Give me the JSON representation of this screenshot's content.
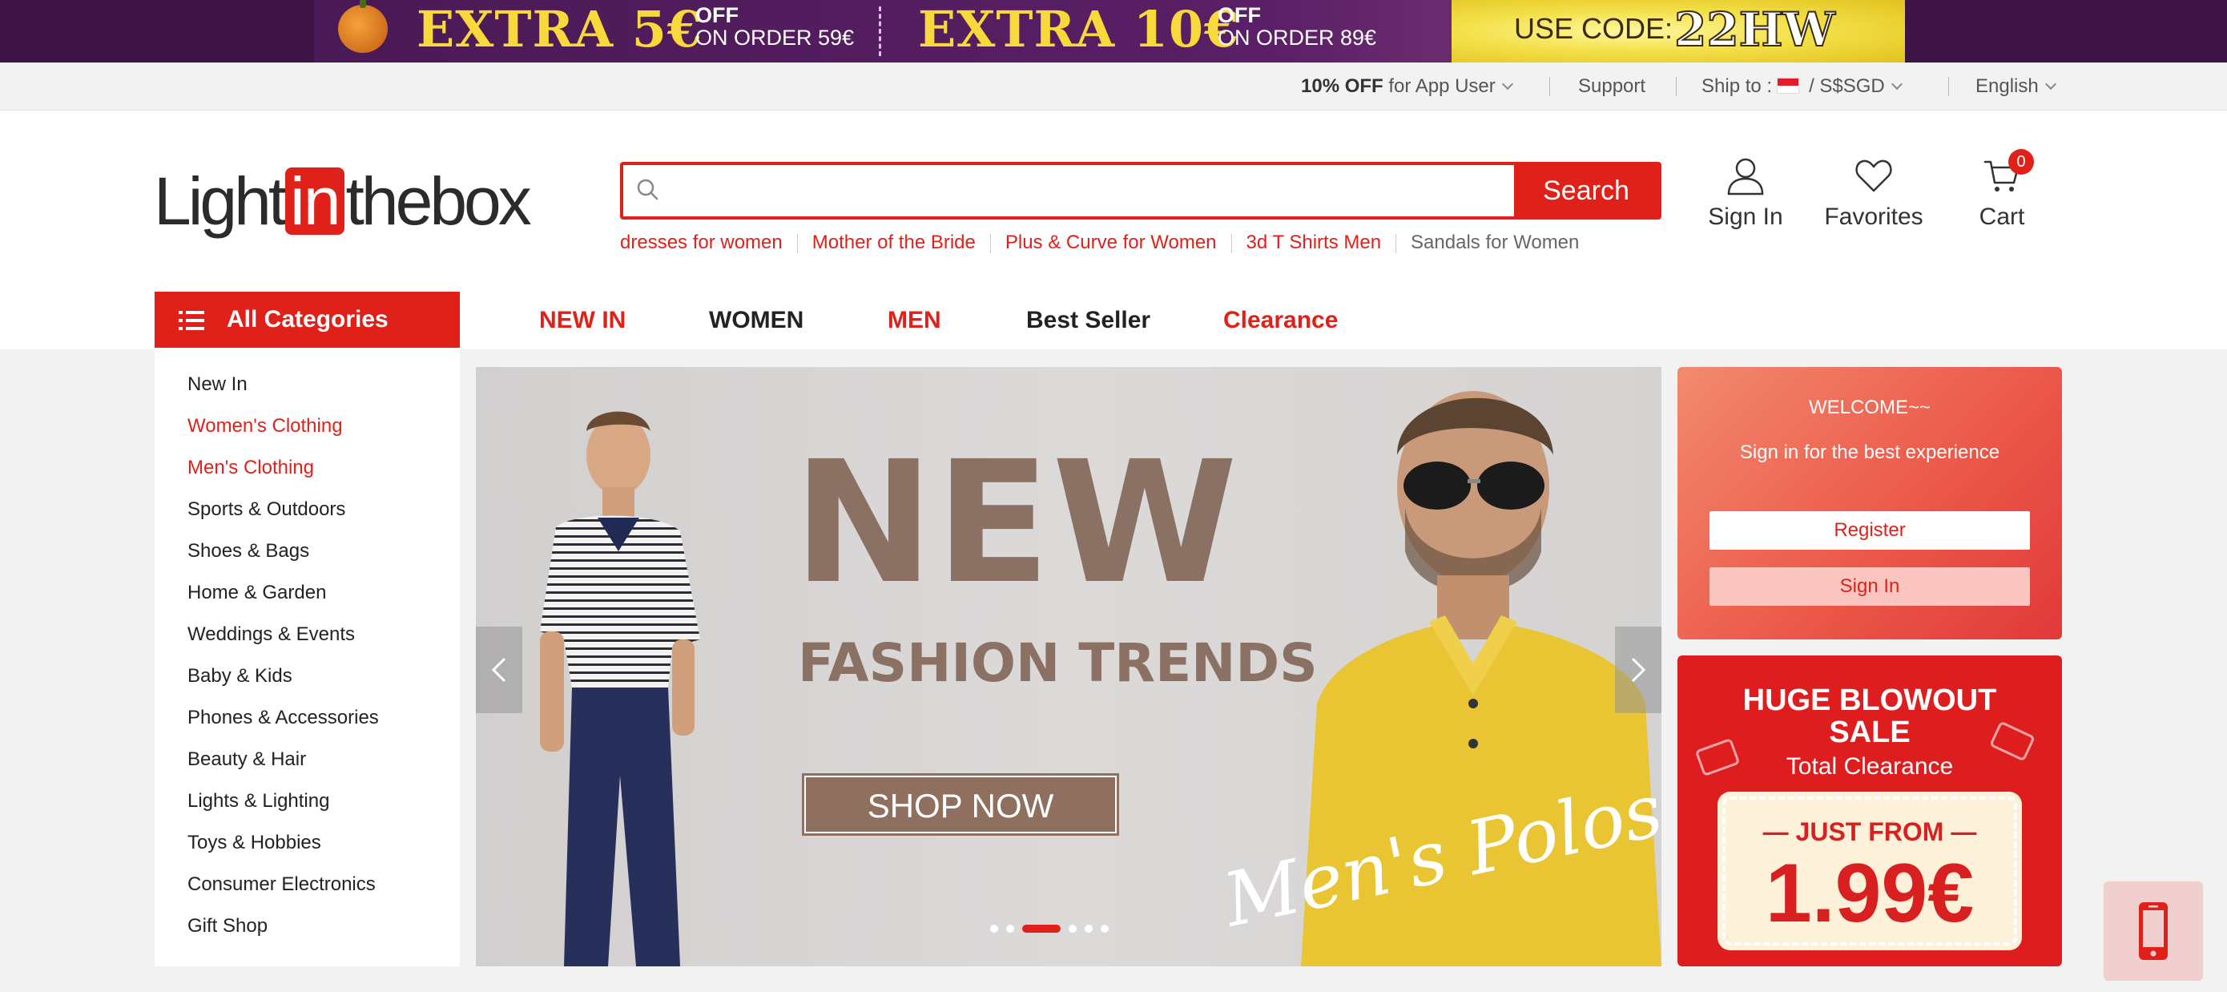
{
  "promo": {
    "offer1_big": "EXTRA 5€",
    "offer1_off": "OFF",
    "offer1_order": "ON ORDER 59€",
    "offer2_big": "EXTRA 10€",
    "offer2_off": "OFF",
    "offer2_order": "ON ORDER 89€",
    "code_label": "USE CODE:",
    "code": "22HW"
  },
  "utility": {
    "app_offer_bold": "10% OFF",
    "app_offer_rest": "for App User",
    "support": "Support",
    "ship_label": "Ship to :",
    "currency": "/ S$SGD",
    "language": "English"
  },
  "header": {
    "logo_left": "Light",
    "logo_in": "in",
    "logo_right": "thebox",
    "search_placeholder": "",
    "search_button": "Search",
    "hot_searches": [
      "dresses for women",
      "Mother of the Bride",
      "Plus & Curve for Women",
      "3d T Shirts Men",
      "Sandals for Women"
    ],
    "sign_in": "Sign In",
    "favorites": "Favorites",
    "cart": "Cart",
    "cart_count": "0"
  },
  "nav": {
    "all_categories": "All Categories",
    "items": [
      "NEW IN",
      "WOMEN",
      "MEN",
      "Best Seller",
      "Clearance"
    ]
  },
  "sidebar": {
    "items": [
      "New In",
      "Women's Clothing",
      "Men's Clothing",
      "Sports & Outdoors",
      "Shoes & Bags",
      "Home & Garden",
      "Weddings & Events",
      "Baby & Kids",
      "Phones & Accessories",
      "Beauty & Hair",
      "Lights & Lighting",
      "Toys & Hobbies",
      "Consumer Electronics",
      "Gift Shop"
    ]
  },
  "hero": {
    "headline": "NEW",
    "subhead": "FASHION TRENDS",
    "cta": "SHOP NOW",
    "script": "Men's Polos",
    "slide_count": 6,
    "active_slide": 3
  },
  "welcome": {
    "title": "WELCOME~~",
    "subtitle": "Sign in for the best experience",
    "register": "Register",
    "sign_in": "Sign In"
  },
  "blowout": {
    "title": "HUGE BLOWOUT SALE",
    "subtitle": "Total Clearance",
    "from": "— JUST FROM —",
    "price": "1.99€"
  },
  "colors": {
    "brand_red": "#e0211a",
    "promo_purple": "#4a1a55",
    "promo_yellow": "#f7d93b",
    "hero_brown": "#8b7064"
  }
}
